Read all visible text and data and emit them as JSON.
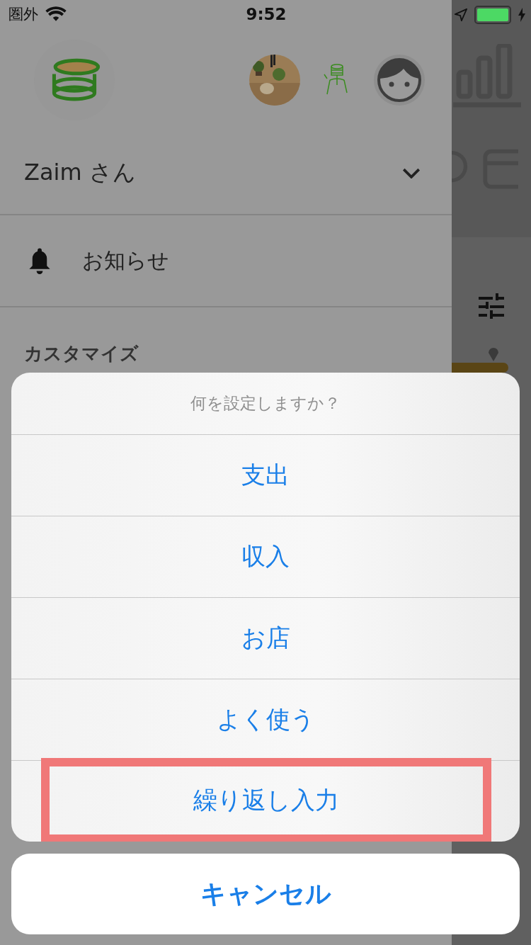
{
  "status_bar": {
    "carrier": "圏外",
    "time": "9:52"
  },
  "drawer": {
    "user_name": "Zaim さん",
    "menu_items": [
      {
        "label": "お知らせ"
      }
    ],
    "section_header": "カスタマイズ"
  },
  "action_sheet": {
    "title": "何を設定しますか？",
    "actions": [
      {
        "label": "支出",
        "highlighted": false
      },
      {
        "label": "収入",
        "highlighted": false
      },
      {
        "label": "お店",
        "highlighted": false
      },
      {
        "label": "よく使う",
        "highlighted": false
      },
      {
        "label": "繰り返し入力",
        "highlighted": true
      }
    ],
    "cancel": "キャンセル"
  }
}
